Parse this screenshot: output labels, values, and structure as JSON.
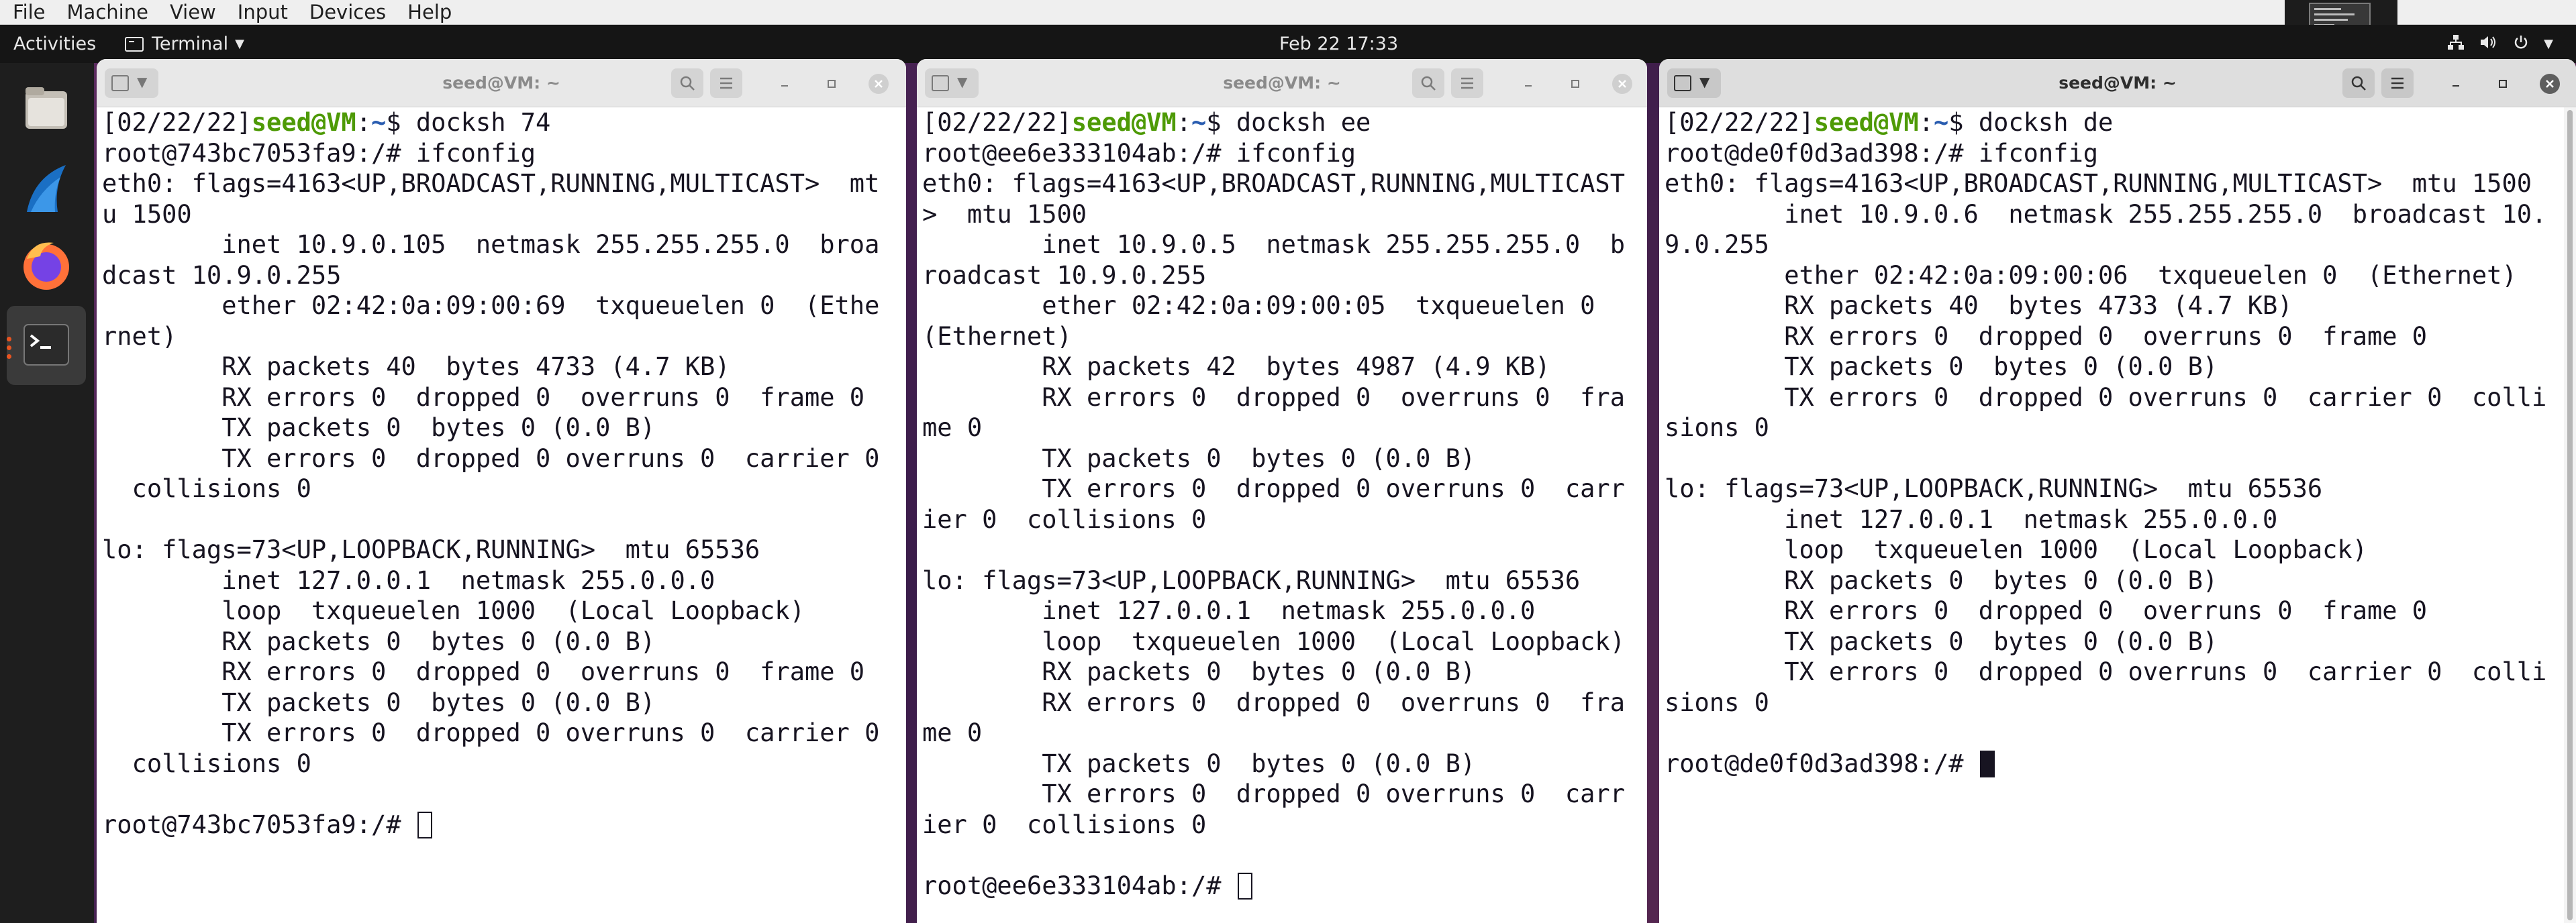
{
  "host": {
    "menu": [
      "File",
      "Machine",
      "View",
      "Input",
      "Devices",
      "Help"
    ]
  },
  "topbar": {
    "activities": "Activities",
    "app_name": "Terminal",
    "clock": "Feb 22  17:33",
    "tray_icons": [
      "network-icon",
      "volume-icon",
      "power-icon",
      "chevron-down-icon"
    ]
  },
  "dock": {
    "items": [
      "files-icon",
      "wireshark-icon",
      "firefox-icon",
      "terminal-icon"
    ]
  },
  "colors": {
    "prompt_user": "#4e9a06",
    "prompt_path": "#2a5db0",
    "terminal_text": "#171421",
    "topbar_bg": "#151515"
  },
  "windows": [
    {
      "title": "seed@VM: ~",
      "active": false,
      "host_prompt": {
        "date": "[02/22/22]",
        "user": "seed@VM",
        "path": "~",
        "command": "$ docksh 74"
      },
      "lines": [
        "root@743bc7053fa9:/# ifconfig",
        "eth0: flags=4163<UP,BROADCAST,RUNNING,MULTICAST>  mt",
        "u 1500",
        "        inet 10.9.0.105  netmask 255.255.255.0  broa",
        "dcast 10.9.0.255",
        "        ether 02:42:0a:09:00:69  txqueuelen 0  (Ethe",
        "rnet)",
        "        RX packets 40  bytes 4733 (4.7 KB)",
        "        RX errors 0  dropped 0  overruns 0  frame 0",
        "        TX packets 0  bytes 0 (0.0 B)",
        "        TX errors 0  dropped 0 overruns 0  carrier 0",
        "  collisions 0",
        "",
        "lo: flags=73<UP,LOOPBACK,RUNNING>  mtu 65536",
        "        inet 127.0.0.1  netmask 255.0.0.0",
        "        loop  txqueuelen 1000  (Local Loopback)",
        "        RX packets 0  bytes 0 (0.0 B)",
        "        RX errors 0  dropped 0  overruns 0  frame 0",
        "        TX packets 0  bytes 0 (0.0 B)",
        "        TX errors 0  dropped 0 overruns 0  carrier 0",
        "  collisions 0",
        ""
      ],
      "final_prompt": "root@743bc7053fa9:/# "
    },
    {
      "title": "seed@VM: ~",
      "active": false,
      "host_prompt": {
        "date": "[02/22/22]",
        "user": "seed@VM",
        "path": "~",
        "command": "$ docksh ee"
      },
      "lines": [
        "root@ee6e333104ab:/# ifconfig",
        "eth0: flags=4163<UP,BROADCAST,RUNNING,MULTICAST",
        ">  mtu 1500",
        "        inet 10.9.0.5  netmask 255.255.255.0  b",
        "roadcast 10.9.0.255",
        "        ether 02:42:0a:09:00:05  txqueuelen 0",
        "(Ethernet)",
        "        RX packets 42  bytes 4987 (4.9 KB)",
        "        RX errors 0  dropped 0  overruns 0  fra",
        "me 0",
        "        TX packets 0  bytes 0 (0.0 B)",
        "        TX errors 0  dropped 0 overruns 0  carr",
        "ier 0  collisions 0",
        "",
        "lo: flags=73<UP,LOOPBACK,RUNNING>  mtu 65536",
        "        inet 127.0.0.1  netmask 255.0.0.0",
        "        loop  txqueuelen 1000  (Local Loopback)",
        "        RX packets 0  bytes 0 (0.0 B)",
        "        RX errors 0  dropped 0  overruns 0  fra",
        "me 0",
        "        TX packets 0  bytes 0 (0.0 B)",
        "        TX errors 0  dropped 0 overruns 0  carr",
        "ier 0  collisions 0",
        ""
      ],
      "final_prompt": "root@ee6e333104ab:/# "
    },
    {
      "title": "seed@VM: ~",
      "active": true,
      "host_prompt": {
        "date": "[02/22/22]",
        "user": "seed@VM",
        "path": "~",
        "command": "$ docksh de"
      },
      "lines": [
        "root@de0f0d3ad398:/# ifconfig",
        "eth0: flags=4163<UP,BROADCAST,RUNNING,MULTICAST>  mtu 1500",
        "        inet 10.9.0.6  netmask 255.255.255.0  broadcast 10.",
        "9.0.255",
        "        ether 02:42:0a:09:00:06  txqueuelen 0  (Ethernet)",
        "        RX packets 40  bytes 4733 (4.7 KB)",
        "        RX errors 0  dropped 0  overruns 0  frame 0",
        "        TX packets 0  bytes 0 (0.0 B)",
        "        TX errors 0  dropped 0 overruns 0  carrier 0  colli",
        "sions 0",
        "",
        "lo: flags=73<UP,LOOPBACK,RUNNING>  mtu 65536",
        "        inet 127.0.0.1  netmask 255.0.0.0",
        "        loop  txqueuelen 1000  (Local Loopback)",
        "        RX packets 0  bytes 0 (0.0 B)",
        "        RX errors 0  dropped 0  overruns 0  frame 0",
        "        TX packets 0  bytes 0 (0.0 B)",
        "        TX errors 0  dropped 0 overruns 0  carrier 0  colli",
        "sions 0",
        ""
      ],
      "final_prompt": "root@de0f0d3ad398:/# "
    }
  ]
}
